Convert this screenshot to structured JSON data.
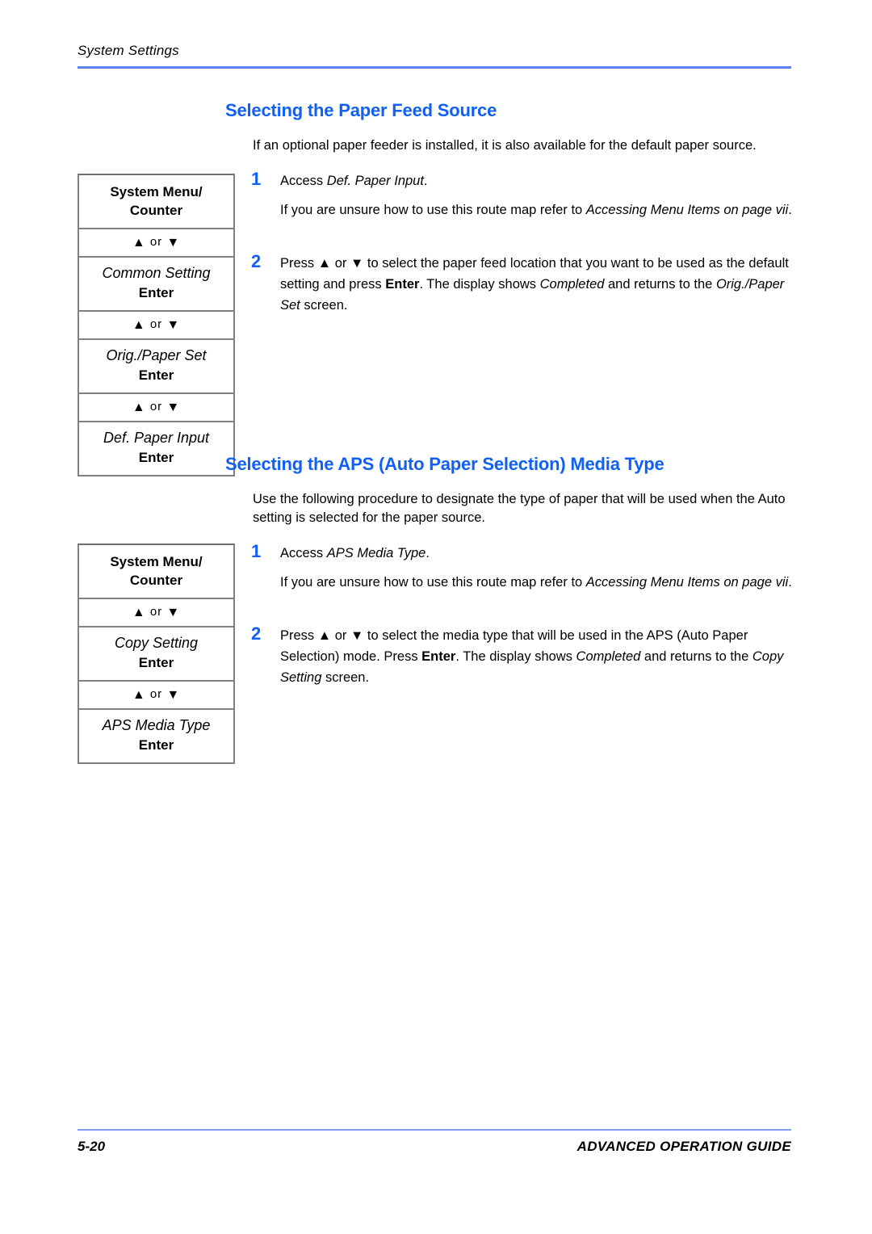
{
  "header": {
    "running_head": "System Settings"
  },
  "footer": {
    "page_number": "5-20",
    "guide_title": "ADVANCED OPERATION GUIDE"
  },
  "colors": {
    "heading_blue": "#1060f5",
    "rule_blue": "#5b82f0",
    "step_number_blue": "#1060f5",
    "table_border_gray": "#808080"
  },
  "sections": [
    {
      "heading": "Selecting the Paper Feed Source",
      "intro": "If an optional paper feeder is installed, it is also available for the default paper source.",
      "routemap": {
        "cells": [
          {
            "type": "key",
            "label": "System Menu/ Counter"
          },
          {
            "type": "arrow",
            "prefix_icon": "up-triangle-icon",
            "conjunction": "or",
            "suffix_icon": "down-triangle-icon"
          },
          {
            "type": "menu",
            "label": "Common Setting",
            "key": "Enter"
          },
          {
            "type": "arrow",
            "prefix_icon": "up-triangle-icon",
            "conjunction": "or",
            "suffix_icon": "down-triangle-icon"
          },
          {
            "type": "menu",
            "label": "Orig./Paper Set",
            "key": "Enter"
          },
          {
            "type": "arrow",
            "prefix_icon": "up-triangle-icon",
            "conjunction": "or",
            "suffix_icon": "down-triangle-icon"
          },
          {
            "type": "menu",
            "label": "Def. Paper Input",
            "key": "Enter"
          }
        ]
      },
      "steps": [
        {
          "number": "1",
          "paragraphs": [
            {
              "runs": [
                {
                  "t": "Access ",
                  "s": "normal"
                },
                {
                  "t": "Def. Paper Input",
                  "s": "italic"
                },
                {
                  "t": ".",
                  "s": "normal"
                }
              ]
            },
            {
              "runs": [
                {
                  "t": "If you are unsure how to use this route map refer to ",
                  "s": "normal"
                },
                {
                  "t": "Accessing Menu Items on page vii",
                  "s": "italic"
                },
                {
                  "t": ".",
                  "s": "normal"
                }
              ]
            }
          ]
        },
        {
          "number": "2",
          "paragraphs": [
            {
              "runs": [
                {
                  "t": "Press ",
                  "s": "normal"
                },
                {
                  "t": "▲",
                  "s": "glyph"
                },
                {
                  "t": " or ",
                  "s": "normal"
                },
                {
                  "t": "▼",
                  "s": "glyph"
                },
                {
                  "t": " to select the paper feed location that you want to be used as the default setting and press ",
                  "s": "normal"
                },
                {
                  "t": "Enter",
                  "s": "bold"
                },
                {
                  "t": ". The display shows ",
                  "s": "normal"
                },
                {
                  "t": "Completed",
                  "s": "italic"
                },
                {
                  "t": " and returns to the ",
                  "s": "normal"
                },
                {
                  "t": "Orig./Paper Set",
                  "s": "italic"
                },
                {
                  "t": " screen.",
                  "s": "normal"
                }
              ]
            }
          ]
        }
      ]
    },
    {
      "heading": "Selecting the APS (Auto Paper Selection) Media Type",
      "intro": "Use the following procedure to designate the type of paper that will be used when the Auto setting is selected for the paper source.",
      "routemap": {
        "cells": [
          {
            "type": "key",
            "label": "System Menu/ Counter"
          },
          {
            "type": "arrow",
            "prefix_icon": "up-triangle-icon",
            "conjunction": "or",
            "suffix_icon": "down-triangle-icon"
          },
          {
            "type": "menu",
            "label": "Copy Setting",
            "key": "Enter"
          },
          {
            "type": "arrow",
            "prefix_icon": "up-triangle-icon",
            "conjunction": "or",
            "suffix_icon": "down-triangle-icon"
          },
          {
            "type": "menu",
            "label": "APS Media Type",
            "key": "Enter"
          }
        ]
      },
      "steps": [
        {
          "number": "1",
          "paragraphs": [
            {
              "runs": [
                {
                  "t": "Access ",
                  "s": "normal"
                },
                {
                  "t": "APS Media Type",
                  "s": "italic"
                },
                {
                  "t": ".",
                  "s": "normal"
                }
              ]
            },
            {
              "runs": [
                {
                  "t": "If you are unsure how to use this route map refer to ",
                  "s": "normal"
                },
                {
                  "t": "Accessing Menu Items on page vii",
                  "s": "italic"
                },
                {
                  "t": ".",
                  "s": "normal"
                }
              ]
            }
          ]
        },
        {
          "number": "2",
          "paragraphs": [
            {
              "runs": [
                {
                  "t": "Press ",
                  "s": "normal"
                },
                {
                  "t": "▲",
                  "s": "glyph"
                },
                {
                  "t": " or ",
                  "s": "normal"
                },
                {
                  "t": "▼",
                  "s": "glyph"
                },
                {
                  "t": " to select the media type that will be used in the APS (Auto Paper Selection) mode. Press ",
                  "s": "normal"
                },
                {
                  "t": "Enter",
                  "s": "bold"
                },
                {
                  "t": ". The display shows ",
                  "s": "normal"
                },
                {
                  "t": "Completed",
                  "s": "italic"
                },
                {
                  "t": " and returns to the ",
                  "s": "normal"
                },
                {
                  "t": "Copy Setting",
                  "s": "italic"
                },
                {
                  "t": " screen.",
                  "s": "normal"
                }
              ]
            }
          ]
        }
      ]
    }
  ],
  "glyphs": {
    "up_triangle": "▲",
    "down_triangle": "▼"
  }
}
